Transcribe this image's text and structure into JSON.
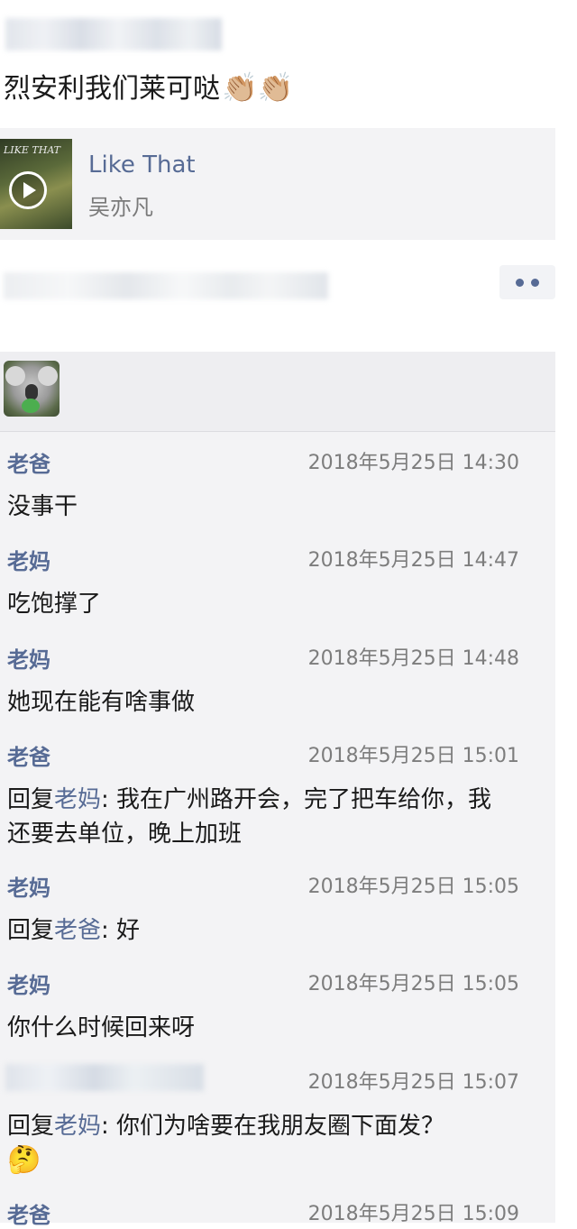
{
  "post": {
    "text": "烈安利我们莱可哒",
    "emoji": "👏🏼👏🏼"
  },
  "music": {
    "album_text": "LIKE THAT",
    "title": "Like That",
    "artist": "吴亦凡"
  },
  "icons": {
    "play": "play-icon",
    "more": "more-dots-icon",
    "avatar": "koala-avatar"
  },
  "colors": {
    "link_blue": "#576b95",
    "card_bg": "#f3f3f5",
    "time_gray": "#7d7d7d"
  },
  "comments": [
    {
      "name": "老爸",
      "time": "2018年5月25日 14:30",
      "prefix": "",
      "reply_to": "",
      "text": "没事干"
    },
    {
      "name": "老妈",
      "time": "2018年5月25日 14:47",
      "prefix": "",
      "reply_to": "",
      "text": "吃饱撑了"
    },
    {
      "name": "老妈",
      "time": "2018年5月25日 14:48",
      "prefix": "",
      "reply_to": "",
      "text": "她现在能有啥事做"
    },
    {
      "name": "老爸",
      "time": "2018年5月25日 15:01",
      "prefix": "回复",
      "reply_to": "老妈",
      "text": ": 我在广州路开会，完了把车给你，我还要去单位，晚上加班"
    },
    {
      "name": "老妈",
      "time": "2018年5月25日 15:05",
      "prefix": "回复",
      "reply_to": "老爸",
      "text": ": 好"
    },
    {
      "name": "老妈",
      "time": "2018年5月25日 15:05",
      "prefix": "",
      "reply_to": "",
      "text": "你什么时候回来呀"
    },
    {
      "name": "",
      "time": "2018年5月25日 15:07",
      "prefix": "回复",
      "reply_to": "老妈",
      "text": ": 你们为啥要在我朋友圈下面发？",
      "emoji": "🤔"
    },
    {
      "name": "老爸",
      "time": "2018年5月25日 15:09",
      "prefix": "",
      "reply_to": "",
      "text": ""
    }
  ]
}
